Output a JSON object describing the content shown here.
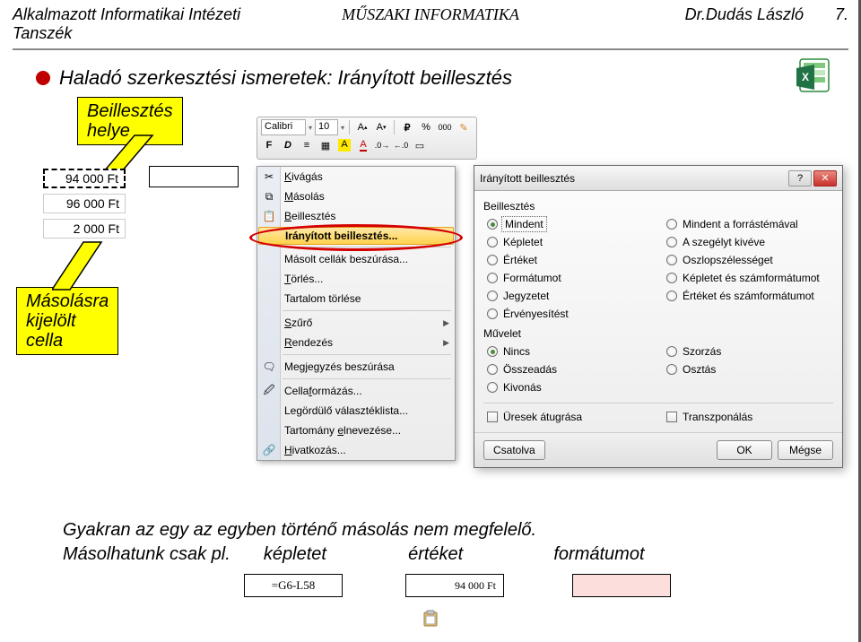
{
  "header": {
    "left": "Alkalmazott Informatikai Intézeti Tanszék",
    "center": "MŰSZAKI INFORMATIKA",
    "right_name": "Dr.Dudás László",
    "right_page": "7."
  },
  "title": "Haladó szerkesztési ismeretek: Irányított beillesztés",
  "callouts": {
    "insert_place": "Beillesztés\nhelye",
    "copy_selected": "Másolásra\nkijelölt\ncella"
  },
  "cells": {
    "c1": "94 000 Ft",
    "c2": "96 000 Ft",
    "c3": "2 000 Ft"
  },
  "mini_toolbar": {
    "font": "Calibri",
    "size": "10",
    "btns": [
      "A˘",
      "A˙",
      "%",
      "000"
    ],
    "row2": [
      "F",
      "D"
    ]
  },
  "context_menu": {
    "items": [
      {
        "label": "Kivágás",
        "u": 0,
        "icon": "scissors"
      },
      {
        "label": "Másolás",
        "u": 0,
        "icon": "copy"
      },
      {
        "label": "Beillesztés",
        "u": 0,
        "icon": "paste"
      },
      {
        "label": "Irányított beillesztés...",
        "u": -1,
        "hl": true
      },
      {
        "sep": true
      },
      {
        "label": "Másolt cellák beszúrása...",
        "u": -1
      },
      {
        "label": "Törlés...",
        "u": 0
      },
      {
        "label": "Tartalom törlése",
        "u": -1
      },
      {
        "sep": true
      },
      {
        "label": "Szűrő",
        "u": 0,
        "arrow": true
      },
      {
        "label": "Rendezés",
        "u": 0,
        "arrow": true
      },
      {
        "sep": true
      },
      {
        "label": "Megjegyzés beszúrása",
        "u": -1,
        "icon": "comment"
      },
      {
        "sep": true
      },
      {
        "label": "Cellaformázás...",
        "u": 5,
        "icon": "format"
      },
      {
        "label": "Legördülő választéklista...",
        "u": -1
      },
      {
        "label": "Tartomány elnevezése...",
        "u": 10
      },
      {
        "label": "Hivatkozás...",
        "u": 0,
        "icon": "link"
      }
    ]
  },
  "dialog": {
    "title": "Irányított beillesztés",
    "section_paste": "Beillesztés",
    "paste_options_left": [
      "Mindent",
      "Képletet",
      "Értéket",
      "Formátumot",
      "Jegyzetet",
      "Érvényesítést"
    ],
    "paste_options_right": [
      "Mindent a forrástémával",
      "A szegélyt kivéve",
      "Oszlopszélességet",
      "Képletet és számformátumot",
      "Értéket és számformátumot"
    ],
    "paste_checked": "Mindent",
    "section_op": "Művelet",
    "op_left": [
      "Nincs",
      "Összeadás",
      "Kivonás"
    ],
    "op_right": [
      "Szorzás",
      "Osztás"
    ],
    "op_checked": "Nincs",
    "checks": {
      "skip_blanks": "Üresek átugrása",
      "transpose": "Transzponálás"
    },
    "buttons": {
      "link": "Csatolva",
      "ok": "OK",
      "cancel": "Mégse"
    }
  },
  "bottom": {
    "line1": "Gyakran az egy az egyben történő másolás nem megfelelő.",
    "line2a": "Másolhatunk csak pl.",
    "line2b": "képletet",
    "line2c": "értéket",
    "line2d": "formátumot",
    "formula": "=G6-L58",
    "value": "94 000 Ft"
  }
}
